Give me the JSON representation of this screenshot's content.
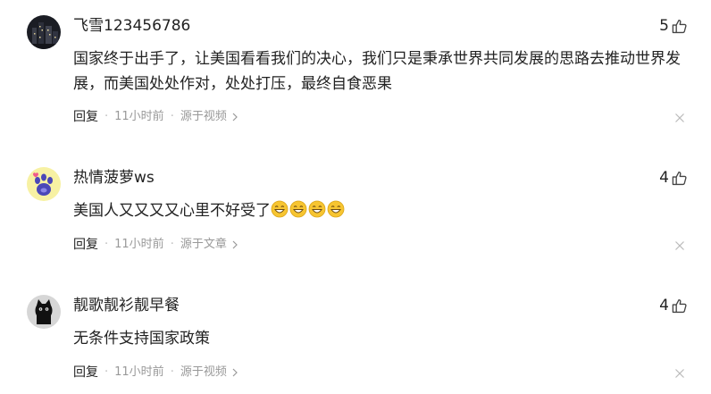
{
  "comments": [
    {
      "username": "飞雪123456786",
      "likes": "5",
      "text": "国家终于出手了，让美国看看我们的决心，我们只是秉承世界共同发展的思路去推动世界发展，而美国处处作对，处处打压，最终自食恶果",
      "reply_label": "回复",
      "time": "11小时前",
      "source": "源于视频",
      "avatar_icon": "night-city-avatar"
    },
    {
      "username": "热情菠萝ws",
      "likes": "4",
      "text": "美国人又又又又心里不好受了",
      "emoji_icon": "grinning-face-emoji",
      "reply_label": "回复",
      "time": "11小时前",
      "source": "源于文章",
      "avatar_icon": "paw-heart-avatar"
    },
    {
      "username": "靓歌靓衫靓早餐",
      "likes": "4",
      "text": "无条件支持国家政策",
      "reply_label": "回复",
      "time": "11小时前",
      "source": "源于视频",
      "avatar_icon": "black-cat-avatar"
    }
  ],
  "colors": {
    "text": "#222222",
    "meta": "#999999",
    "icon": "#555555"
  }
}
